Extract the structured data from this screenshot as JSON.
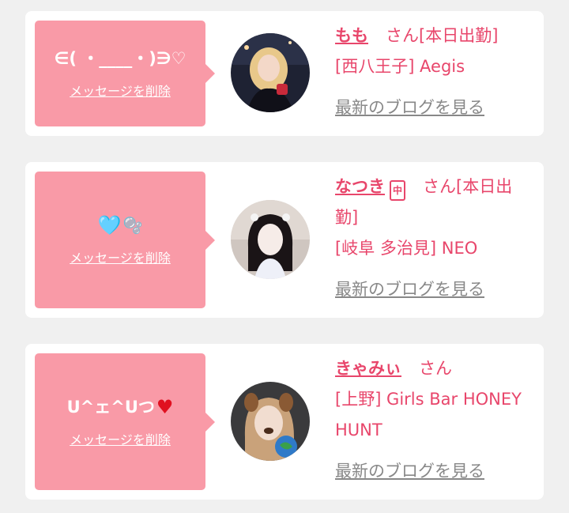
{
  "messages": [
    {
      "text": "∈( ・____・)∋♡",
      "delete_label": "メッセージを削除",
      "name": "もも",
      "suffix": "さん[本日出勤]",
      "shop": "[西八王子] Aegis",
      "blog_label": "最新のブログを見る",
      "avatar_icon": "avatar-photo-icon"
    },
    {
      "text_heart": "🩵",
      "text_bubbles": "🫧",
      "delete_label": "メッセージを削除",
      "name": "なつき",
      "shift_icon_text": "中",
      "suffix": "さん[本日出勤]",
      "shop": "[岐阜 多治見] NEO",
      "blog_label": "最新のブログを見る",
      "avatar_icon": "avatar-photo-icon"
    },
    {
      "text": "U^ェ^Uつ",
      "text_heart": "♥",
      "delete_label": "メッセージを削除",
      "name": "きゃみぃ",
      "suffix": "さん",
      "shop": "[上野] Girls Bar HONEY HUNT",
      "blog_label": "最新のブログを見る",
      "avatar_icon": "avatar-photo-icon"
    }
  ],
  "colors": {
    "accent": "#e8466b",
    "bubble": "#f99aa7",
    "background": "#f0f0f0",
    "link_gray": "#888888"
  }
}
